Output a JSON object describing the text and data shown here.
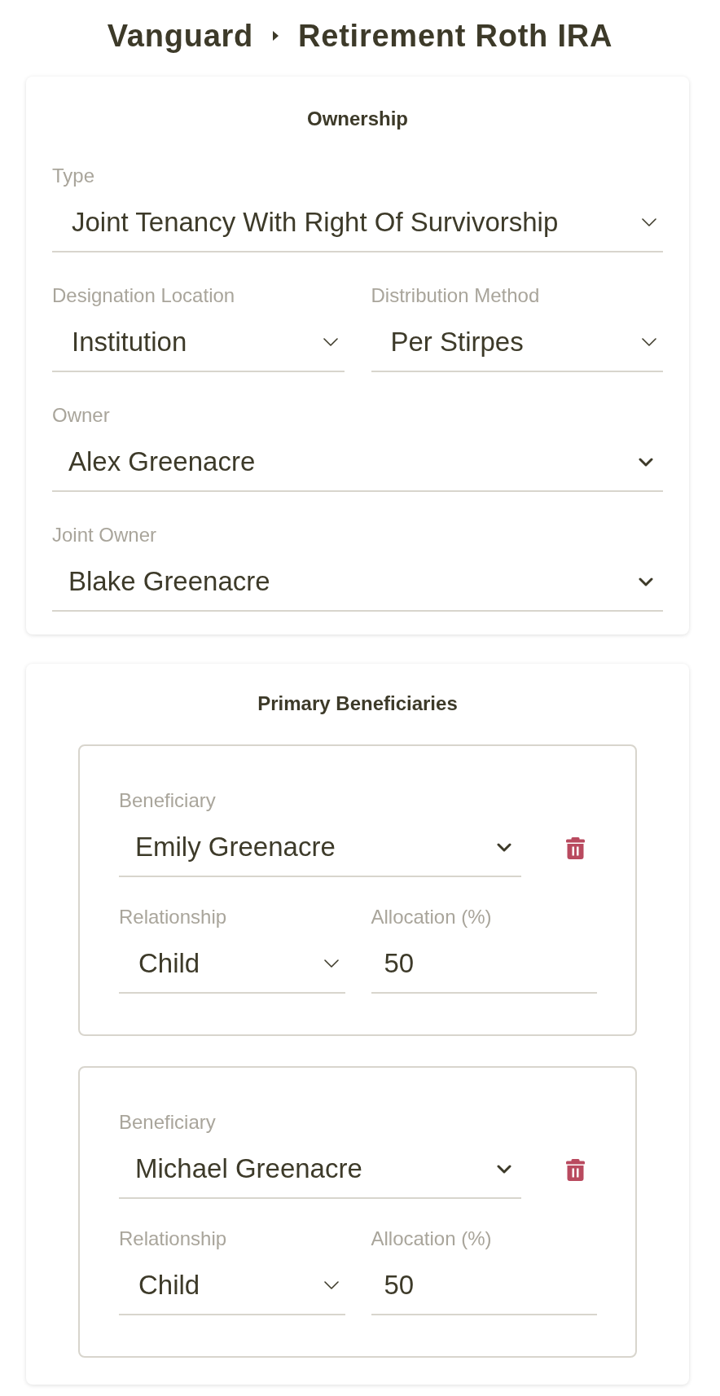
{
  "breadcrumb": [
    {
      "label": "Vanguard"
    },
    {
      "label": "Retirement Roth IRA"
    }
  ],
  "ownership": {
    "title": "Ownership",
    "rows": [
      {
        "fields": [
          {
            "label": "Type",
            "value": "Joint Tenancy With Right Of Survivorship",
            "kind": "select"
          }
        ]
      },
      {
        "fields": [
          {
            "label": "Designation Location",
            "value": "Institution",
            "kind": "select"
          },
          {
            "label": "Distribution Method",
            "value": "Per Stirpes",
            "kind": "select"
          }
        ]
      },
      {
        "fields": [
          {
            "label": "Owner",
            "value": "Alex Greenacre",
            "kind": "combobox"
          }
        ]
      },
      {
        "fields": [
          {
            "label": "Joint Owner",
            "value": "Blake Greenacre",
            "kind": "combobox"
          }
        ]
      }
    ]
  },
  "primary_beneficiaries": {
    "title": "Primary Beneficiaries",
    "items": [
      {
        "beneficiary": {
          "label": "Beneficiary",
          "value": "Emily Greenacre",
          "kind": "combobox"
        },
        "relationship": {
          "label": "Relationship",
          "value": "Child",
          "kind": "select"
        },
        "allocation": {
          "label": "Allocation (%)",
          "value": "50",
          "kind": "input"
        }
      },
      {
        "beneficiary": {
          "label": "Beneficiary",
          "value": "Michael Greenacre",
          "kind": "combobox"
        },
        "relationship": {
          "label": "Relationship",
          "value": "Child",
          "kind": "select"
        },
        "allocation": {
          "label": "Allocation (%)",
          "value": "50",
          "kind": "input"
        }
      }
    ]
  }
}
